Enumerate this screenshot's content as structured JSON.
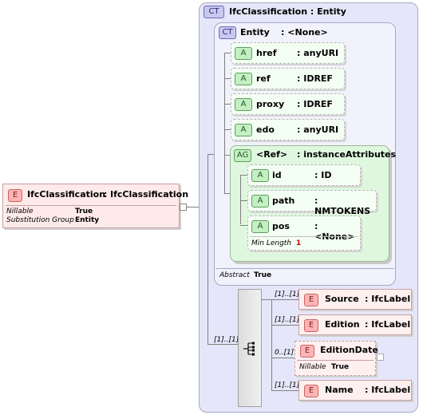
{
  "root_element": {
    "badge": "E",
    "name": "IfcClassification",
    "separator": ":",
    "type": "IfcClassification",
    "props": [
      {
        "label": "Nillable",
        "value": "True"
      },
      {
        "label": "Substitution Group",
        "value": "Entity"
      }
    ]
  },
  "outer_type": {
    "badge": "CT",
    "title": "IfcClassification : Entity"
  },
  "entity_type": {
    "badge": "CT",
    "name": "Entity",
    "type": ": <None>",
    "abstract_label": "Abstract",
    "abstract_value": "True"
  },
  "attributes": [
    {
      "badge": "A",
      "name": "href",
      "type": ": anyURI"
    },
    {
      "badge": "A",
      "name": "ref",
      "type": ": IDREF"
    },
    {
      "badge": "A",
      "name": "proxy",
      "type": ": IDREF"
    },
    {
      "badge": "A",
      "name": "edo",
      "type": ": anyURI"
    }
  ],
  "attribute_group": {
    "badge": "AG",
    "name": "<Ref>",
    "type": ": instanceAttributes",
    "attributes": [
      {
        "badge": "A",
        "name": "id",
        "type": ": ID"
      },
      {
        "badge": "A",
        "name": "path",
        "type": ": NMTOKENS"
      },
      {
        "badge": "A",
        "name": "pos",
        "type": ": <None>",
        "min_length_label": "Min Length",
        "min_length_value": "1"
      }
    ]
  },
  "sequence": {
    "occurrence": "[1]..[1]"
  },
  "children": [
    {
      "badge": "E",
      "name": "Source",
      "type": ": IfcLabel",
      "occurrence": "[1]..[1]"
    },
    {
      "badge": "E",
      "name": "Edition",
      "type": ": IfcLabel",
      "occurrence": "[1]..[1]"
    },
    {
      "badge": "E",
      "name": "EditionDate",
      "type": "",
      "occurrence": "0..[1]",
      "prop_label": "Nillable",
      "prop_value": "True"
    },
    {
      "badge": "E",
      "name": "Name",
      "type": ": IfcLabel",
      "occurrence": "[1]..[1]"
    }
  ],
  "colors": {
    "element": "#ffb4b4",
    "attribute": "#c4eec4",
    "complex_type": "#c8c8f0",
    "required": "#d00000"
  }
}
